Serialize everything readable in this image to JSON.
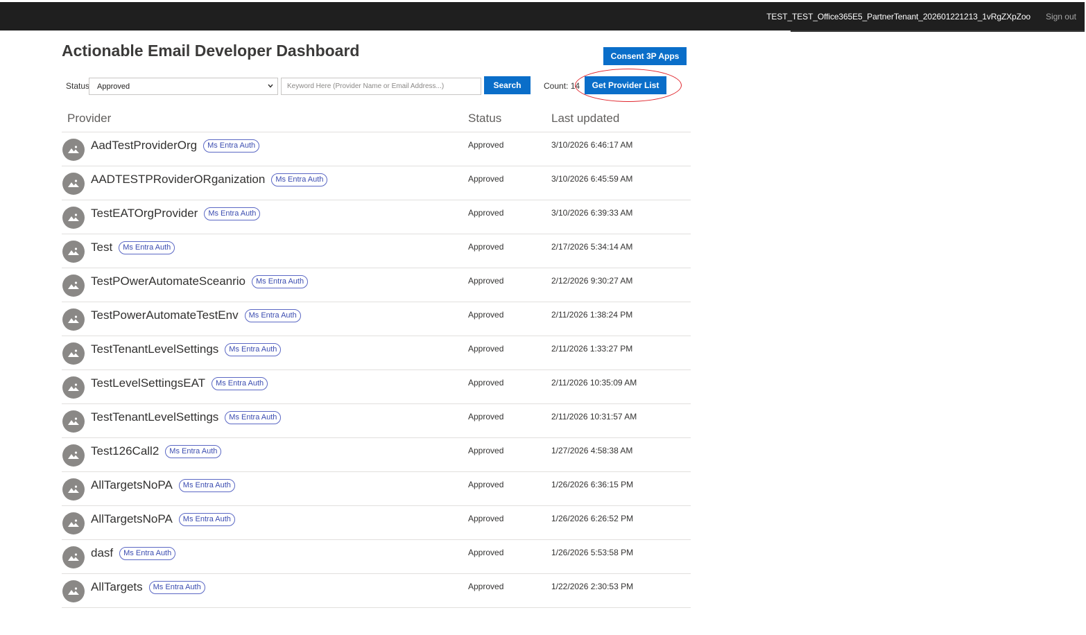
{
  "header": {
    "tenant": "TEST_TEST_Office365E5_PartnerTenant_202601221213_1vRgZXpZoo",
    "signout_label": "Sign out"
  },
  "page": {
    "title": "Actionable Email Developer Dashboard",
    "consent_label": "Consent 3P Apps"
  },
  "filters": {
    "status_label": "Status",
    "status_value": "Approved",
    "keyword_placeholder": "Keyword Here (Provider Name or Email Address...)",
    "search_label": "Search",
    "count_label": "Count: 14",
    "get_list_label": "Get Provider List"
  },
  "table": {
    "headers": {
      "provider": "Provider",
      "status": "Status",
      "updated": "Last updated"
    },
    "rows": [
      {
        "name": "AadTestProviderOrg",
        "badge": "Ms Entra Auth",
        "status": "Approved",
        "updated": "3/10/2026 6:46:17 AM"
      },
      {
        "name": "AADTESTPRoviderORganization",
        "badge": "Ms Entra Auth",
        "status": "Approved",
        "updated": "3/10/2026 6:45:59 AM"
      },
      {
        "name": "TestEATOrgProvider",
        "badge": "Ms Entra Auth",
        "status": "Approved",
        "updated": "3/10/2026 6:39:33 AM"
      },
      {
        "name": "Test",
        "badge": "Ms Entra Auth",
        "status": "Approved",
        "updated": "2/17/2026 5:34:14 AM"
      },
      {
        "name": "TestPOwerAutomateSceanrio",
        "badge": "Ms Entra Auth",
        "status": "Approved",
        "updated": "2/12/2026 9:30:27 AM"
      },
      {
        "name": "TestPowerAutomateTestEnv",
        "badge": "Ms Entra Auth",
        "status": "Approved",
        "updated": "2/11/2026 1:38:24 PM"
      },
      {
        "name": "TestTenantLevelSettings",
        "badge": "Ms Entra Auth",
        "status": "Approved",
        "updated": "2/11/2026 1:33:27 PM"
      },
      {
        "name": "TestLevelSettingsEAT",
        "badge": "Ms Entra Auth",
        "status": "Approved",
        "updated": "2/11/2026 10:35:09 AM"
      },
      {
        "name": "TestTenantLevelSettings",
        "badge": "Ms Entra Auth",
        "status": "Approved",
        "updated": "2/11/2026 10:31:57 AM"
      },
      {
        "name": "Test126Call2",
        "badge": "Ms Entra Auth",
        "status": "Approved",
        "updated": "1/27/2026 4:58:38 AM"
      },
      {
        "name": "AllTargetsNoPA",
        "badge": "Ms Entra Auth",
        "status": "Approved",
        "updated": "1/26/2026 6:36:15 PM"
      },
      {
        "name": "AllTargetsNoPA",
        "badge": "Ms Entra Auth",
        "status": "Approved",
        "updated": "1/26/2026 6:26:52 PM"
      },
      {
        "name": "dasf",
        "badge": "Ms Entra Auth",
        "status": "Approved",
        "updated": "1/26/2026 5:53:58 PM"
      },
      {
        "name": "AllTargets",
        "badge": "Ms Entra Auth",
        "status": "Approved",
        "updated": "1/22/2026 2:30:53 PM"
      }
    ]
  },
  "colors": {
    "topbar": "#1f1f1f",
    "primary_button": "#0a6ec9",
    "highlight_ring": "#e0242b",
    "badge_border": "#5a67c4"
  },
  "icons": {
    "avatar": "image-placeholder-icon",
    "dropdown": "chevron-down-icon"
  }
}
